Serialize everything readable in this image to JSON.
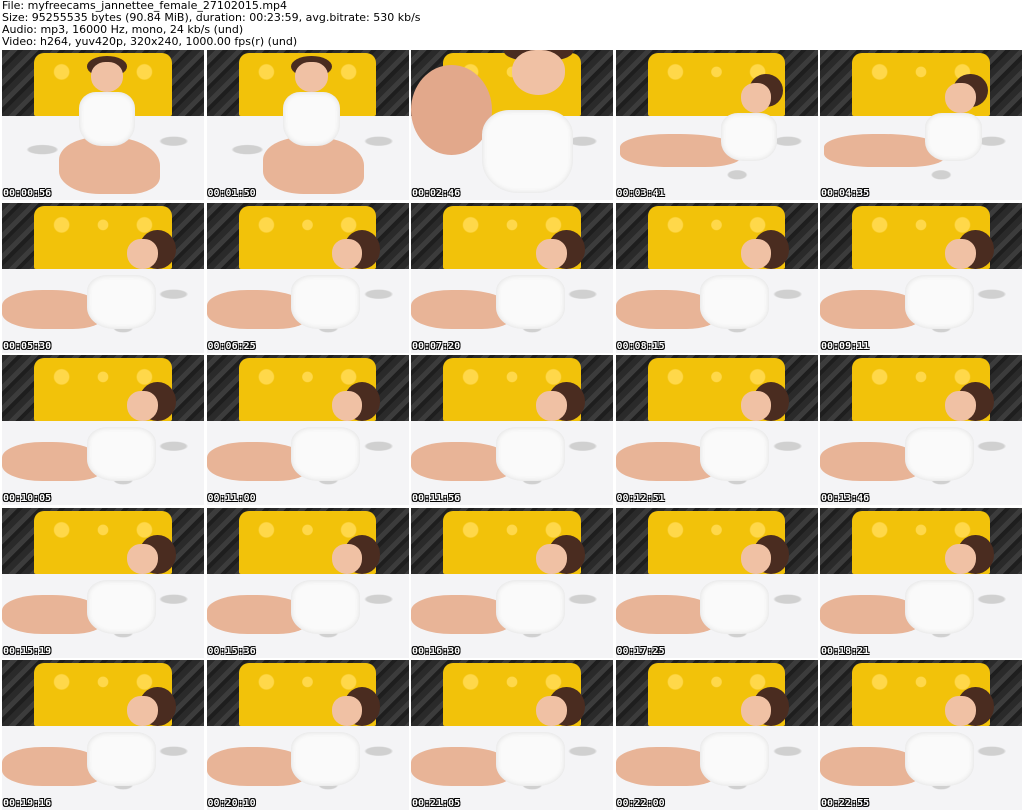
{
  "header": {
    "file": "File: myfreecams_jannettee_female_27102015.mp4",
    "size": "Size: 95255535 bytes (90.84 MiB), duration: 00:23:59, avg.bitrate: 530 kb/s",
    "audio": "Audio: mp3, 16000 Hz, mono, 24 kb/s (und)",
    "video": "Video: h264, yuv420p, 320x240, 1000.00 fps(r) (und)"
  },
  "thumbnails": [
    {
      "time": "00:00:56",
      "pose": "sit"
    },
    {
      "time": "00:01:50",
      "pose": "sit"
    },
    {
      "time": "00:02:46",
      "pose": "close"
    },
    {
      "time": "00:03:41",
      "pose": "lie"
    },
    {
      "time": "00:04:35",
      "pose": "lie"
    },
    {
      "time": "00:05:30",
      "pose": "lean"
    },
    {
      "time": "00:06:25",
      "pose": "lean"
    },
    {
      "time": "00:07:20",
      "pose": "lean"
    },
    {
      "time": "00:08:15",
      "pose": "lean"
    },
    {
      "time": "00:09:11",
      "pose": "lean"
    },
    {
      "time": "00:10:05",
      "pose": "lean"
    },
    {
      "time": "00:11:00",
      "pose": "lean"
    },
    {
      "time": "00:11:56",
      "pose": "lean"
    },
    {
      "time": "00:12:51",
      "pose": "lean"
    },
    {
      "time": "00:13:46",
      "pose": "lean"
    },
    {
      "time": "00:15:19",
      "pose": "lean"
    },
    {
      "time": "00:15:36",
      "pose": "lean"
    },
    {
      "time": "00:16:30",
      "pose": "lean"
    },
    {
      "time": "00:17:25",
      "pose": "lean"
    },
    {
      "time": "00:18:21",
      "pose": "lean"
    },
    {
      "time": "00:19:16",
      "pose": "lean"
    },
    {
      "time": "00:20:10",
      "pose": "lean"
    },
    {
      "time": "00:21:05",
      "pose": "lean"
    },
    {
      "time": "00:22:00",
      "pose": "lean"
    },
    {
      "time": "00:22:55",
      "pose": "lean"
    }
  ],
  "colors": {
    "headboard": "#f2c20a",
    "wall": "#2a2a2a",
    "sheet": "#f4f4f6",
    "top": "#fafafa"
  }
}
